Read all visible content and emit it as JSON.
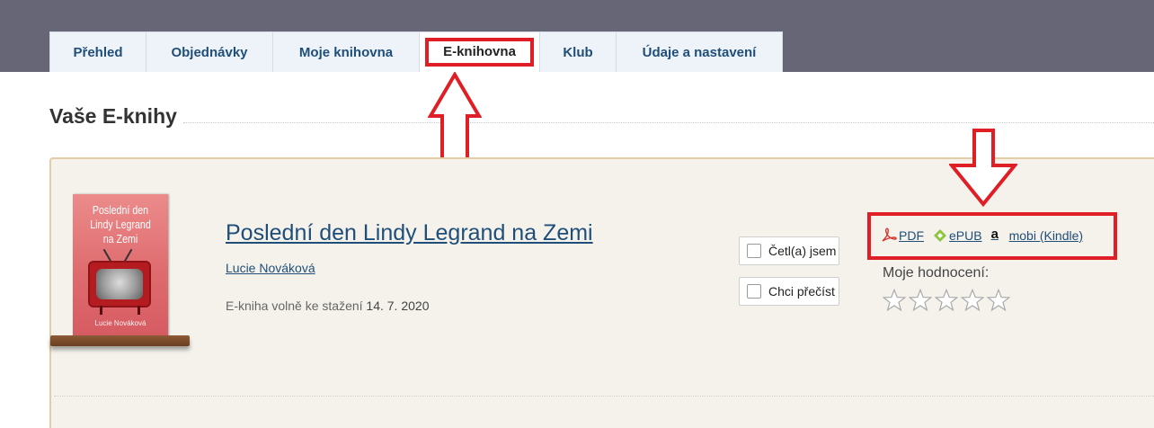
{
  "tabs": [
    {
      "label": "Přehled"
    },
    {
      "label": "Objednávky"
    },
    {
      "label": "Moje knihovna"
    },
    {
      "label": "E-knihovna",
      "active": true
    },
    {
      "label": "Klub"
    },
    {
      "label": "Údaje a nastavení"
    }
  ],
  "section": {
    "title": "Vaše E-knihy"
  },
  "book": {
    "cover": {
      "title": "Poslední den Lindy Legrand na Zemi",
      "author": "Lucie Nováková"
    },
    "title": "Poslední den Lindy Legrand na Zemi",
    "author": "Lucie Nováková",
    "free_label": "E-kniha volně ke stažení",
    "free_date": "14. 7. 2020"
  },
  "actions": {
    "read": "Četl(a) jsem",
    "want": "Chci přečíst"
  },
  "downloads": [
    {
      "label": "PDF",
      "icon": "pdf-icon"
    },
    {
      "label": "ePUB",
      "icon": "epub-icon"
    },
    {
      "label": "mobi (Kindle)",
      "icon": "amazon-icon"
    }
  ],
  "rating": {
    "label": "Moje hodnocení:",
    "value": 0,
    "max": 5
  },
  "colors": {
    "highlight": "#e01e26",
    "link": "#1f4e79",
    "header_bg": "#676677",
    "card_bg": "#f4f2eb"
  }
}
